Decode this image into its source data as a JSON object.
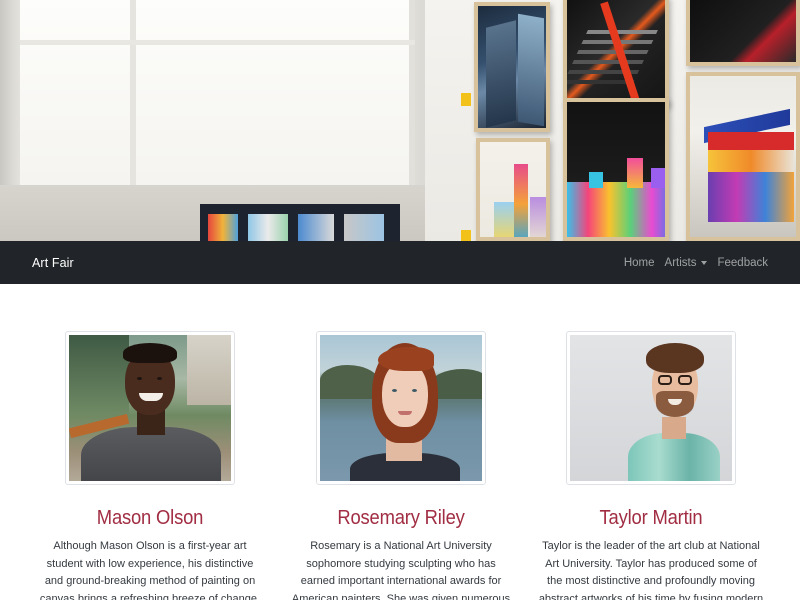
{
  "navbar": {
    "brand": "Art Fair",
    "links": [
      {
        "label": "Home"
      },
      {
        "label": "Artists"
      },
      {
        "label": "Feedback"
      }
    ]
  },
  "artists": [
    {
      "name": "Mason Olson",
      "bio": "Although Mason Olson is a first-year art student with low experience, his distinctive and ground-breaking method of painting on canvas brings a refreshing breeze of change. Anyone who attends this Art Fair will"
    },
    {
      "name": "Rosemary Riley",
      "bio": "Rosemary is a National Art University sophomore studying sculpting who has earned important international awards for American painters. She was given numerous scholarships by the National Art"
    },
    {
      "name": "Taylor Martin",
      "bio": "Taylor is the leader of the art club at National Art University. Taylor has produced some of the most distinctive and profoundly moving abstract artworks of his time by fusing modern art and traditional art and"
    }
  ],
  "colors": {
    "navbar_bg": "#212529",
    "artist_name": "#a12d43",
    "body_text": "#343a40"
  }
}
